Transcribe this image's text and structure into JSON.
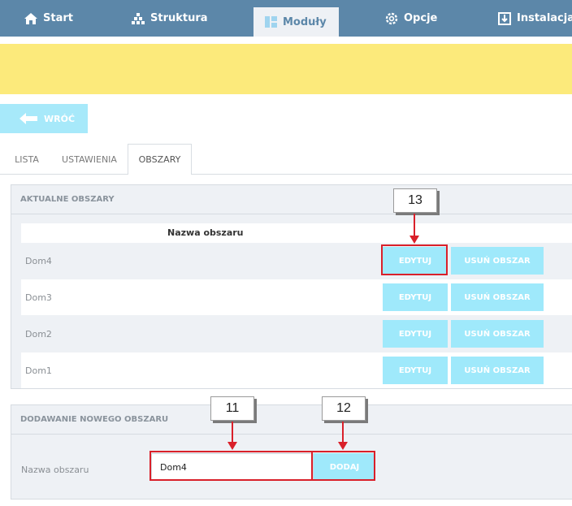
{
  "nav": {
    "items": [
      {
        "label": "Start",
        "icon": "home-icon"
      },
      {
        "label": "Struktura",
        "icon": "tree-icon"
      },
      {
        "label": "Moduły",
        "icon": "grid-icon"
      },
      {
        "label": "Opcje",
        "icon": "gear-icon"
      },
      {
        "label": "Instalacja",
        "icon": "download-icon"
      }
    ],
    "active": "Moduły"
  },
  "back_button": {
    "label": "WRÓĆ"
  },
  "tabs": [
    {
      "label": "LISTA"
    },
    {
      "label": "USTAWIENIA"
    },
    {
      "label": "OBSZARY"
    }
  ],
  "active_tab": "OBSZARY",
  "areas_panel": {
    "title": "AKTUALNE OBSZARY",
    "column_header": "Nazwa obszaru",
    "rows": [
      {
        "name": "Dom4",
        "edit_label": "EDYTUJ",
        "delete_label": "USUŃ OBSZAR"
      },
      {
        "name": "Dom3",
        "edit_label": "EDYTUJ",
        "delete_label": "USUŃ OBSZAR"
      },
      {
        "name": "Dom2",
        "edit_label": "EDYTUJ",
        "delete_label": "USUŃ OBSZAR"
      },
      {
        "name": "Dom1",
        "edit_label": "EDYTUJ",
        "delete_label": "USUŃ OBSZAR"
      }
    ]
  },
  "add_panel": {
    "title": "DODAWANIE NOWEGO OBSZARU",
    "field_label": "Nazwa obszaru",
    "field_value": "Dom4",
    "submit_label": "DODAJ"
  },
  "callouts": {
    "c13": "13",
    "c11": "11",
    "c12": "12"
  },
  "colors": {
    "nav_bg": "#5c87a9",
    "accent_button": "#9fe9fb",
    "notice_bar": "#fcea7b",
    "highlight": "#d9202a"
  }
}
